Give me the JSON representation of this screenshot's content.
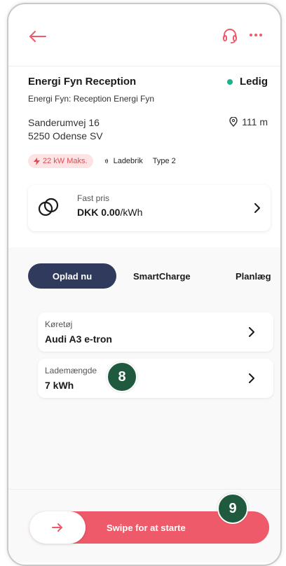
{
  "colors": {
    "accent": "#ef5a6a",
    "available": "#19b38c",
    "tab_active_bg": "#2f3a5c",
    "badge_bg": "#1f5a3e"
  },
  "header": {
    "icons": [
      "arrow-left-icon",
      "headset-icon",
      "more-horizontal-icon"
    ]
  },
  "station": {
    "name": "Energi Fyn Reception",
    "status": "Ledig",
    "operator": "Energi Fyn: Reception Energi Fyn",
    "address_line1": "Sanderumvej 16",
    "address_line2": "5250 Odense SV",
    "distance": "111 m"
  },
  "tags": {
    "power": "22 kW Maks.",
    "type1": "Ladebrik",
    "type2": "Type 2"
  },
  "price": {
    "label": "Fast pris",
    "amount": "DKK 0.00",
    "unit": "/kWh"
  },
  "tabs": [
    {
      "label": "Oplad nu",
      "active": true
    },
    {
      "label": "SmartCharge",
      "active": false
    },
    {
      "label": "Planlæg",
      "active": false
    }
  ],
  "fields": {
    "vehicle_label": "Køretøj",
    "vehicle_value": "Audi A3 e-tron",
    "amount_label": "Lademængde",
    "amount_value": "7 kWh"
  },
  "badges": {
    "step8": "8",
    "step9": "9"
  },
  "swipe": {
    "label": "Swipe for at starte"
  }
}
